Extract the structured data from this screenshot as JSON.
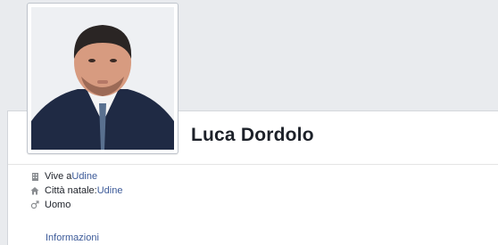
{
  "profile": {
    "name": "Luca Dordolo",
    "photo_alt": "Luca Dordolo"
  },
  "info": [
    {
      "icon": "building-icon",
      "prefix": "Vive a ",
      "link": "Udine"
    },
    {
      "icon": "home-icon",
      "prefix": "Città natale: ",
      "link": "Udine"
    },
    {
      "icon": "male-icon",
      "prefix": "Uomo",
      "link": ""
    }
  ],
  "tabs": {
    "info_label": "Informazioni"
  },
  "colors": {
    "background": "#e9ebee",
    "link": "#3b5998",
    "text": "#1d2129"
  }
}
